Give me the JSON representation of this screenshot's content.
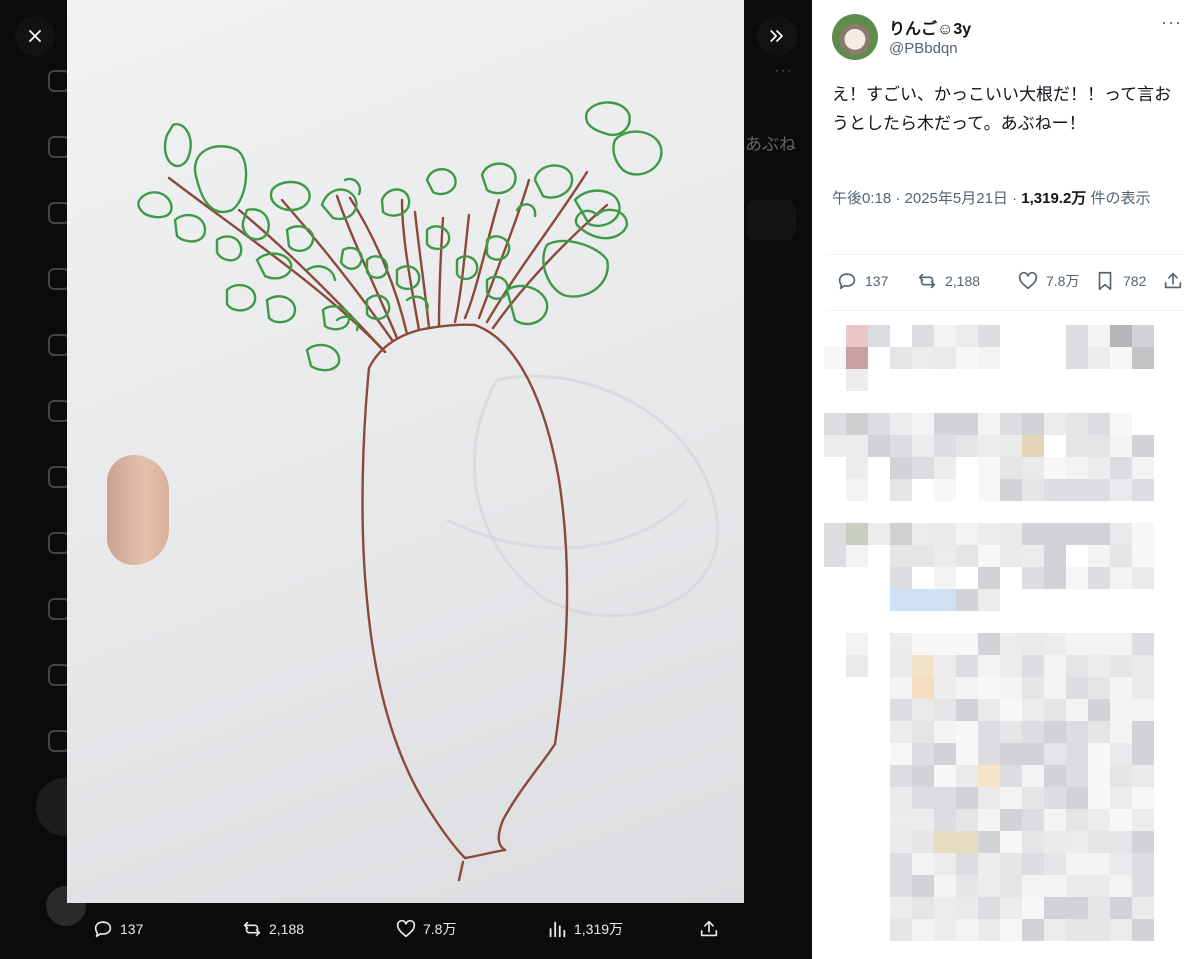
{
  "viewer": {
    "close_icon": "close-icon",
    "expand_icon": "double-chevron-right-icon",
    "background_text": "あぶね",
    "actions": {
      "reply_count": "137",
      "repost_count": "2,188",
      "like_count": "7.8万",
      "views_count": "1,319万"
    }
  },
  "tweet": {
    "author_name": "りんご☺3y",
    "author_handle": "@PBbdqn",
    "text": "え！すごい、かっこいい大根だ！！って言おうとしたら木だって。あぶねー！",
    "timestamp": "午後0:18 · 2025年5月21日",
    "separator": " · ",
    "views_number": "1,319.2万",
    "views_label": " 件の表示",
    "stats": {
      "replies": "137",
      "reposts": "2,188",
      "likes": "7.8万",
      "bookmarks": "782"
    }
  },
  "colors": {
    "stem": "#8a4a3a",
    "leaves": "#3f9a45",
    "panel_text": "#0f1419",
    "muted": "#536471"
  }
}
